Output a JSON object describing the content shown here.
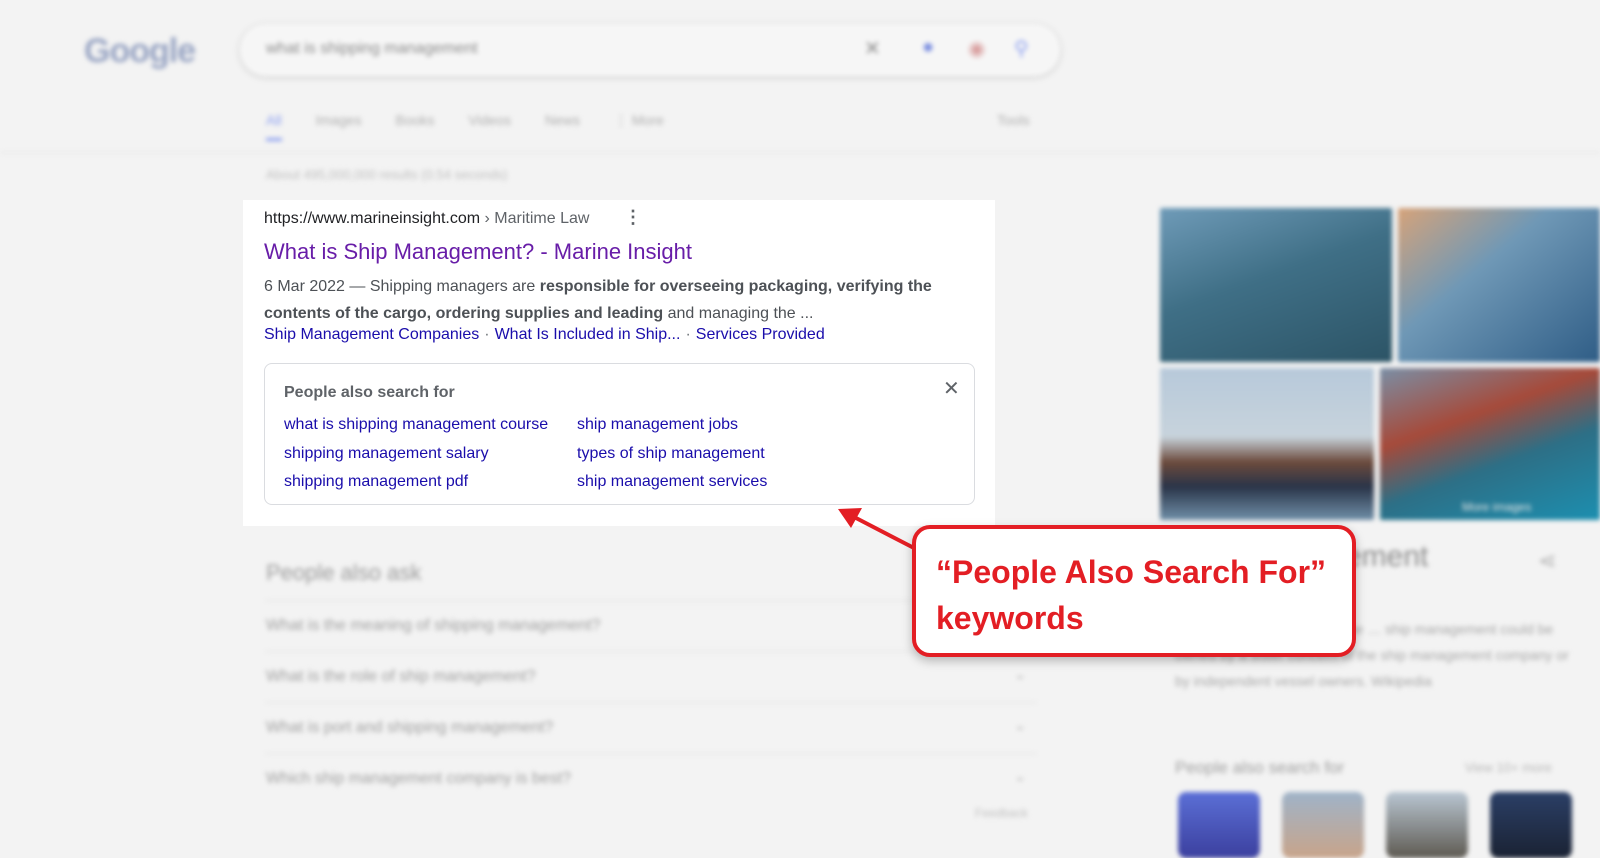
{
  "background": {
    "logo_text": "Google",
    "search_query": "what is shipping management",
    "nav_tabs": [
      "All",
      "Images",
      "Books",
      "Videos",
      "News",
      "⋮ More"
    ],
    "tools_label": "Tools",
    "results_stats": "About 495,000,000 results (0.54 seconds)",
    "paa_title": "People also ask",
    "paa_questions": [
      "What is the meaning of shipping management?",
      "What is the role of ship management?",
      "What is port and shipping management?",
      "Which ship management company is best?"
    ],
    "feedback_label": "Feedback",
    "kp_title": "ement",
    "kp_description": "… activity of managing marine … ship management could be owned by a sister concern of the ship management company or by independent vessel owners. Wikipedia",
    "kp_pasf": "People also search for",
    "kp_view_more": "View 10+ more",
    "more_images": "More images"
  },
  "result": {
    "url": "https://www.marineinsight.com",
    "breadcrumb": "› Maritime Law",
    "title": "What is Ship Management? - Marine Insight",
    "date": "6 Mar 2022 — ",
    "snippet_1": "Shipping managers are ",
    "snippet_bold": "responsible for overseeing packaging, verifying the contents of the cargo, ordering supplies and leading",
    "snippet_2": " and managing the ...",
    "sitelinks": [
      "Ship Management Companies",
      "What Is Included in Ship...",
      "Services Provided"
    ],
    "sitelink_separator": "·"
  },
  "pasf": {
    "title": "People also search for",
    "close_glyph": "✕",
    "links_col1": [
      "what is shipping management course",
      "shipping management salary",
      "shipping management pdf"
    ],
    "links_col2": [
      "ship management jobs",
      "types of ship management",
      "ship management services"
    ]
  },
  "annotation": {
    "callout_line1": "“People Also Search For”",
    "callout_line2": "keywords",
    "color": "#e31e24"
  }
}
